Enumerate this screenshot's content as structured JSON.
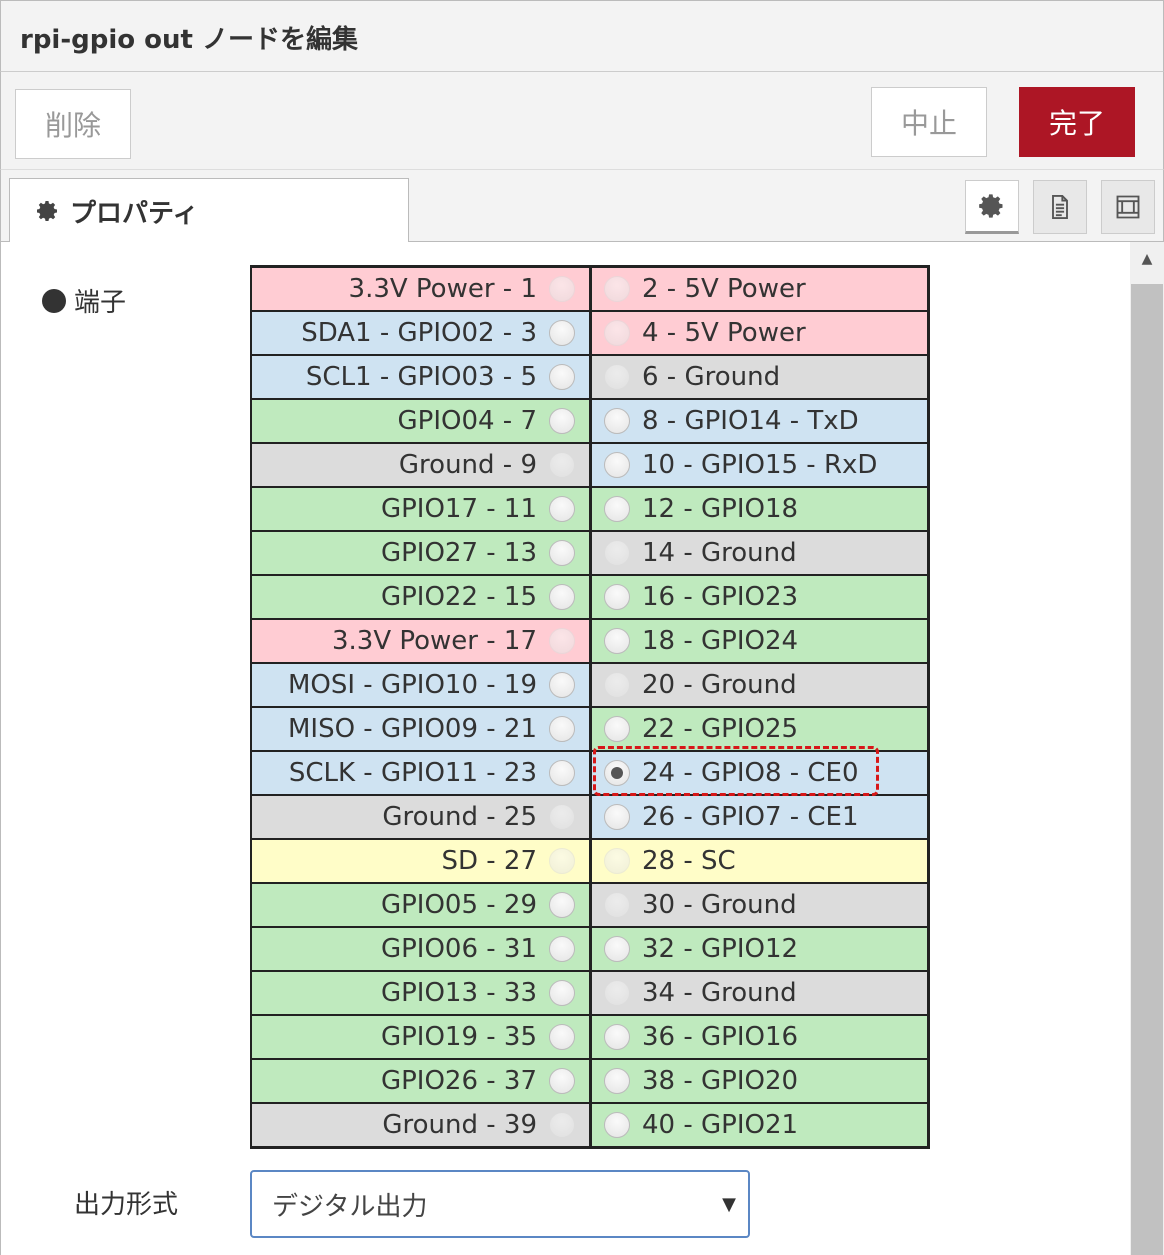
{
  "header": {
    "title": "rpi-gpio out ノードを編集"
  },
  "toolbar": {
    "delete_label": "削除",
    "cancel_label": "中止",
    "done_label": "完了",
    "done_color": "#ad1625"
  },
  "tabs": {
    "properties_label": "プロパティ"
  },
  "form": {
    "pin_label": "端子",
    "output_type_label": "出力形式",
    "output_type_value": "デジタル出力",
    "selected_pin": 24,
    "pins": [
      {
        "left": "3.3V Power - 1",
        "left_kind": "power",
        "right": "2 - 5V Power",
        "right_kind": "power"
      },
      {
        "left": "SDA1 - GPIO02 - 3",
        "left_kind": "comm",
        "right": "4 - 5V Power",
        "right_kind": "power"
      },
      {
        "left": "SCL1 - GPIO03 - 5",
        "left_kind": "comm",
        "right": "6 - Ground",
        "right_kind": "ground"
      },
      {
        "left": "GPIO04 - 7",
        "left_kind": "gpio",
        "right": "8 - GPIO14 - TxD",
        "right_kind": "comm"
      },
      {
        "left": "Ground - 9",
        "left_kind": "ground",
        "right": "10 - GPIO15 - RxD",
        "right_kind": "comm"
      },
      {
        "left": "GPIO17 - 11",
        "left_kind": "gpio",
        "right": "12 - GPIO18",
        "right_kind": "gpio"
      },
      {
        "left": "GPIO27 - 13",
        "left_kind": "gpio",
        "right": "14 - Ground",
        "right_kind": "ground"
      },
      {
        "left": "GPIO22 - 15",
        "left_kind": "gpio",
        "right": "16 - GPIO23",
        "right_kind": "gpio"
      },
      {
        "left": "3.3V Power - 17",
        "left_kind": "power",
        "right": "18 - GPIO24",
        "right_kind": "gpio"
      },
      {
        "left": "MOSI - GPIO10 - 19",
        "left_kind": "comm",
        "right": "20 - Ground",
        "right_kind": "ground"
      },
      {
        "left": "MISO - GPIO09 - 21",
        "left_kind": "comm",
        "right": "22 - GPIO25",
        "right_kind": "gpio"
      },
      {
        "left": "SCLK - GPIO11 - 23",
        "left_kind": "comm",
        "right": "24 - GPIO8 - CE0",
        "right_kind": "comm"
      },
      {
        "left": "Ground - 25",
        "left_kind": "ground",
        "right": "26 - GPIO7 - CE1",
        "right_kind": "comm"
      },
      {
        "left": "SD - 27",
        "left_kind": "sd",
        "right": "28 - SC",
        "right_kind": "sd"
      },
      {
        "left": "GPIO05 - 29",
        "left_kind": "gpio",
        "right": "30 - Ground",
        "right_kind": "ground"
      },
      {
        "left": "GPIO06 - 31",
        "left_kind": "gpio",
        "right": "32 - GPIO12",
        "right_kind": "gpio"
      },
      {
        "left": "GPIO13 - 33",
        "left_kind": "gpio",
        "right": "34 - Ground",
        "right_kind": "ground"
      },
      {
        "left": "GPIO19 - 35",
        "left_kind": "gpio",
        "right": "36 - GPIO16",
        "right_kind": "gpio"
      },
      {
        "left": "GPIO26 - 37",
        "left_kind": "gpio",
        "right": "38 - GPIO20",
        "right_kind": "gpio"
      },
      {
        "left": "Ground - 39",
        "left_kind": "ground",
        "right": "40 - GPIO21",
        "right_kind": "gpio"
      }
    ]
  },
  "icons": {
    "tab": "gear-icon",
    "sidebar_buttons": [
      "gear-icon",
      "document-icon",
      "layout-icon"
    ]
  }
}
